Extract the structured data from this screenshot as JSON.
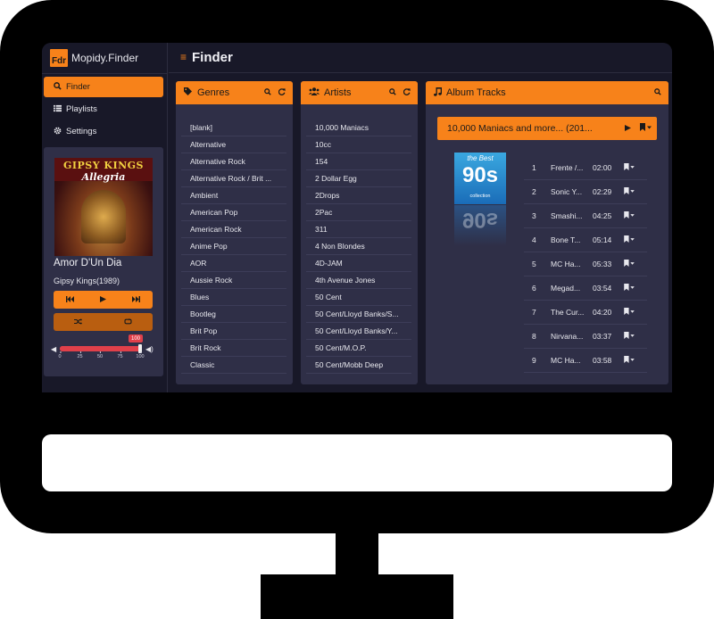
{
  "app": {
    "brand_logo": "Fdr",
    "brand_name": "Mopidy.Finder",
    "page_title": "Finder",
    "accent_color": "#f7821a"
  },
  "nav": [
    {
      "label": "Finder",
      "icon": "search-icon",
      "active": true
    },
    {
      "label": "Playlists",
      "icon": "list-icon",
      "active": false
    },
    {
      "label": "Settings",
      "icon": "gear-icon",
      "active": false
    }
  ],
  "player": {
    "cover_artist_text": "GIPSY KINGS",
    "cover_album_text": "Allegria",
    "track_title": "Amor D'Un Dia",
    "track_artist": "Gipsy Kings(1989)",
    "volume": 100,
    "volume_badge": "100",
    "volume_ticks": [
      "0",
      "25",
      "50",
      "75",
      "100"
    ]
  },
  "panels": {
    "genres": {
      "title": "Genres",
      "items": [
        "[blank]",
        "Alternative",
        "Alternative Rock",
        "Alternative Rock / Brit ...",
        "Ambient",
        "American Pop",
        "American Rock",
        "Anime Pop",
        "AOR",
        "Aussie Rock",
        "Blues",
        "Bootleg",
        "Brit Pop",
        "Brit Rock",
        "Classic"
      ]
    },
    "artists": {
      "title": "Artists",
      "items": [
        "10,000 Maniacs",
        "10cc",
        "154",
        "2 Dollar Egg",
        "2Drops",
        "2Pac",
        "311",
        "4 Non Blondes",
        "4D-JAM",
        "4th Avenue Jones",
        "50 Cent",
        "50 Cent/Lloyd Banks/S...",
        "50 Cent/Lloyd Banks/Y...",
        "50 Cent/M.O.P.",
        "50 Cent/Mobb Deep"
      ]
    },
    "album_tracks": {
      "title": "Album Tracks",
      "album_title": "10,000 Maniacs and more... (201...",
      "cover_text_top": "the Best",
      "cover_text_main": "90s",
      "cover_text_bottom": "collection",
      "tracks": [
        {
          "num": "1",
          "name": "Frente /...",
          "duration": "02:00"
        },
        {
          "num": "2",
          "name": "Sonic Y...",
          "duration": "02:29"
        },
        {
          "num": "3",
          "name": "Smashi...",
          "duration": "04:25"
        },
        {
          "num": "4",
          "name": "Bone T...",
          "duration": "05:14"
        },
        {
          "num": "5",
          "name": "MC Ha...",
          "duration": "05:33"
        },
        {
          "num": "6",
          "name": "Megad...",
          "duration": "03:54"
        },
        {
          "num": "7",
          "name": "The Cur...",
          "duration": "04:20"
        },
        {
          "num": "8",
          "name": "Nirvana...",
          "duration": "03:37"
        },
        {
          "num": "9",
          "name": "MC Ha...",
          "duration": "03:58"
        }
      ]
    }
  }
}
